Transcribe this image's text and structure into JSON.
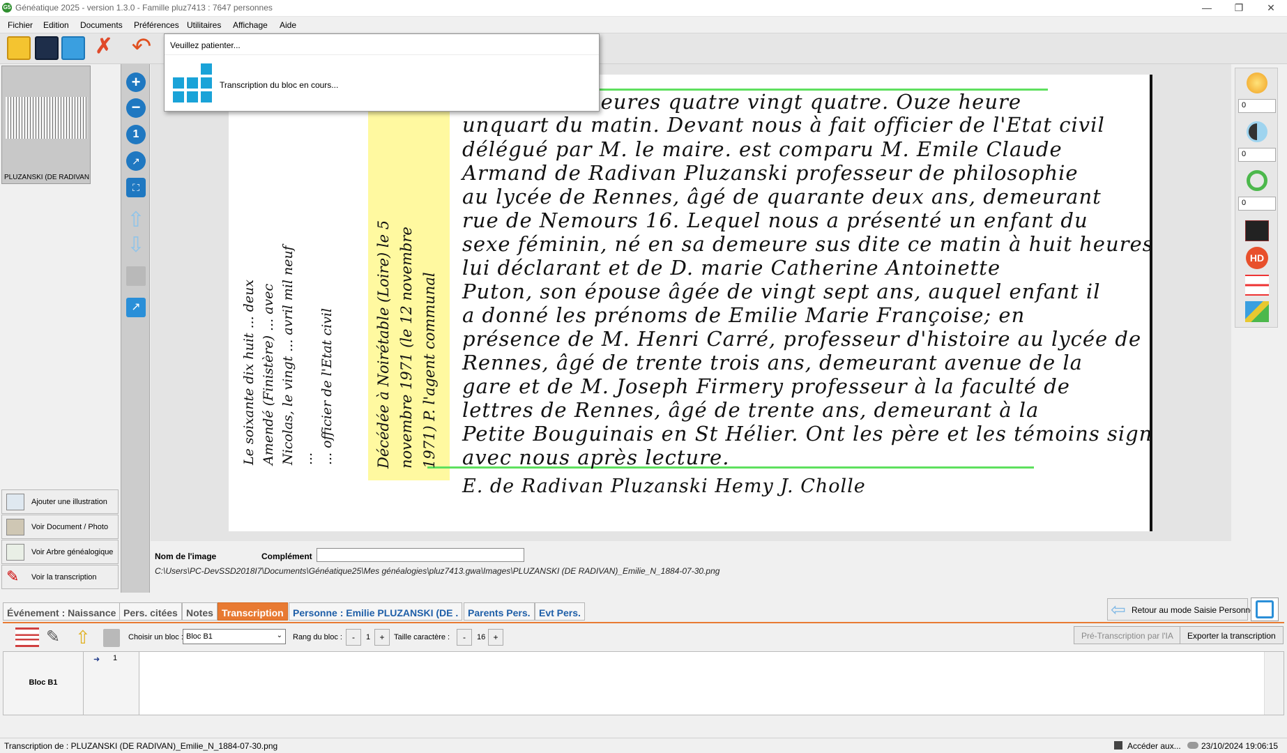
{
  "window": {
    "title": "Généatique 2025 - version 1.3.0 - Famille pluz7413 : 7647 personnes",
    "app_logo_text": "G5"
  },
  "menu": [
    "Fichier",
    "Edition",
    "Documents",
    "Préférences",
    "Utilitaires",
    "Affichage",
    "Aide"
  ],
  "popup": {
    "header": "Veuillez patienter...",
    "message": "Transcription du bloc en cours..."
  },
  "left_panel": {
    "thumbnail_label": "PLUZANSKI (DE RADIVAN",
    "buttons": [
      "Ajouter une illustration",
      "Voir Document / Photo",
      "Voir Arbre généalogique",
      "Voir la transcription"
    ]
  },
  "document": {
    "lines": [
      "trente huit heures quatre vingt quatre. Ouze heure",
      "unquart du matin. Devant nous à fait officier de l'Etat civil",
      "délégué par M. le maire. est comparu M. Emile Claude",
      "Armand de Radivan Pluzanski professeur de philosophie",
      "au lycée de Rennes, âgé de quarante deux ans, demeurant",
      "rue de Nemours 16. Lequel nous a présenté un enfant du",
      "sexe féminin, né en sa demeure sus dite ce matin à huit heures, de",
      "lui déclarant et de D. marie Catherine Antoinette",
      "Puton, son épouse âgée de vingt sept ans, auquel enfant il",
      "a donné les prénoms de Emilie Marie Françoise; en",
      "présence de M. Henri Carré, professeur d'histoire au lycée de",
      "Rennes, âgé de trente trois ans, demeurant avenue de la",
      "gare et de M. Joseph Firmery professeur à la faculté de",
      "lettres de Rennes, âgé de trente ans, demeurant à la",
      "Petite Bouguinais en St Hélier. Ont les père et les témoins signé",
      "avec nous après lecture.",
      "E. de Radivan Pluzanski   Hemy   J. Cholle"
    ],
    "margin_note_lines": [
      "Décédée à Noirétable (Loire) le 5",
      "novembre 1971 (le 12 novembre",
      "1971) P. l'agent communal"
    ],
    "margin_left_lines": [
      "Le soixante dix huit ... deux",
      "Amendé (Finistère) ... avec",
      "Nicolas, le vingt ... avril mil neuf",
      "...",
      "... officier de l'Etat civil"
    ]
  },
  "image_info": {
    "name_label": "Nom de l'image",
    "complement_label": "Complément",
    "complement_value": "",
    "path": "C:\\Users\\PC-DevSSD2018I7\\Documents\\Généatique25\\Mes généalogies\\pluz7413.gwa\\Images\\PLUZANSKI (DE RADIVAN)_Emilie_N_1884-07-30.png"
  },
  "right_tools": {
    "spin_values": [
      "0",
      "0",
      "0"
    ],
    "hd_label": "HD"
  },
  "tabs": [
    {
      "label": "Événement : Naissance",
      "style": "plain"
    },
    {
      "label": "Pers. citées",
      "style": "plain"
    },
    {
      "label": "Notes",
      "style": "plain"
    },
    {
      "label": "Transcription",
      "style": "active"
    },
    {
      "label": "Personne : Emilie PLUZANSKI (DE .",
      "style": "blue"
    },
    {
      "label": "Parents Pers.",
      "style": "blue"
    },
    {
      "label": "Evt Pers.",
      "style": "blue"
    }
  ],
  "retour_label": "Retour au mode Saisie Personne",
  "transcription_toolbar": {
    "block_label": "Choisir un bloc :",
    "block_value": "Bloc B1",
    "rank_label": "Rang du bloc :",
    "rank_value": "1",
    "size_label": "Taille caractère :",
    "size_value": "16",
    "minus": "-",
    "plus": "+",
    "ai_button": "Pré-Transcription par l'IA",
    "export_button": "Exporter la transcription"
  },
  "editor": {
    "block_name": "Bloc B1",
    "line_number": "1",
    "content": ""
  },
  "status": {
    "left": "Transcription de : PLUZANSKI (DE RADIVAN)_Emilie_N_1884-07-30.png",
    "access": "Accéder aux...",
    "datetime": "23/10/2024 19:06:15"
  },
  "colors": {
    "accent_orange": "#e87a32",
    "tab_blue": "#1f5fa8",
    "spinner_blue": "#1aa3d8",
    "highlight_yellow": "#fff9a0",
    "guide_green": "#5ee05e"
  }
}
